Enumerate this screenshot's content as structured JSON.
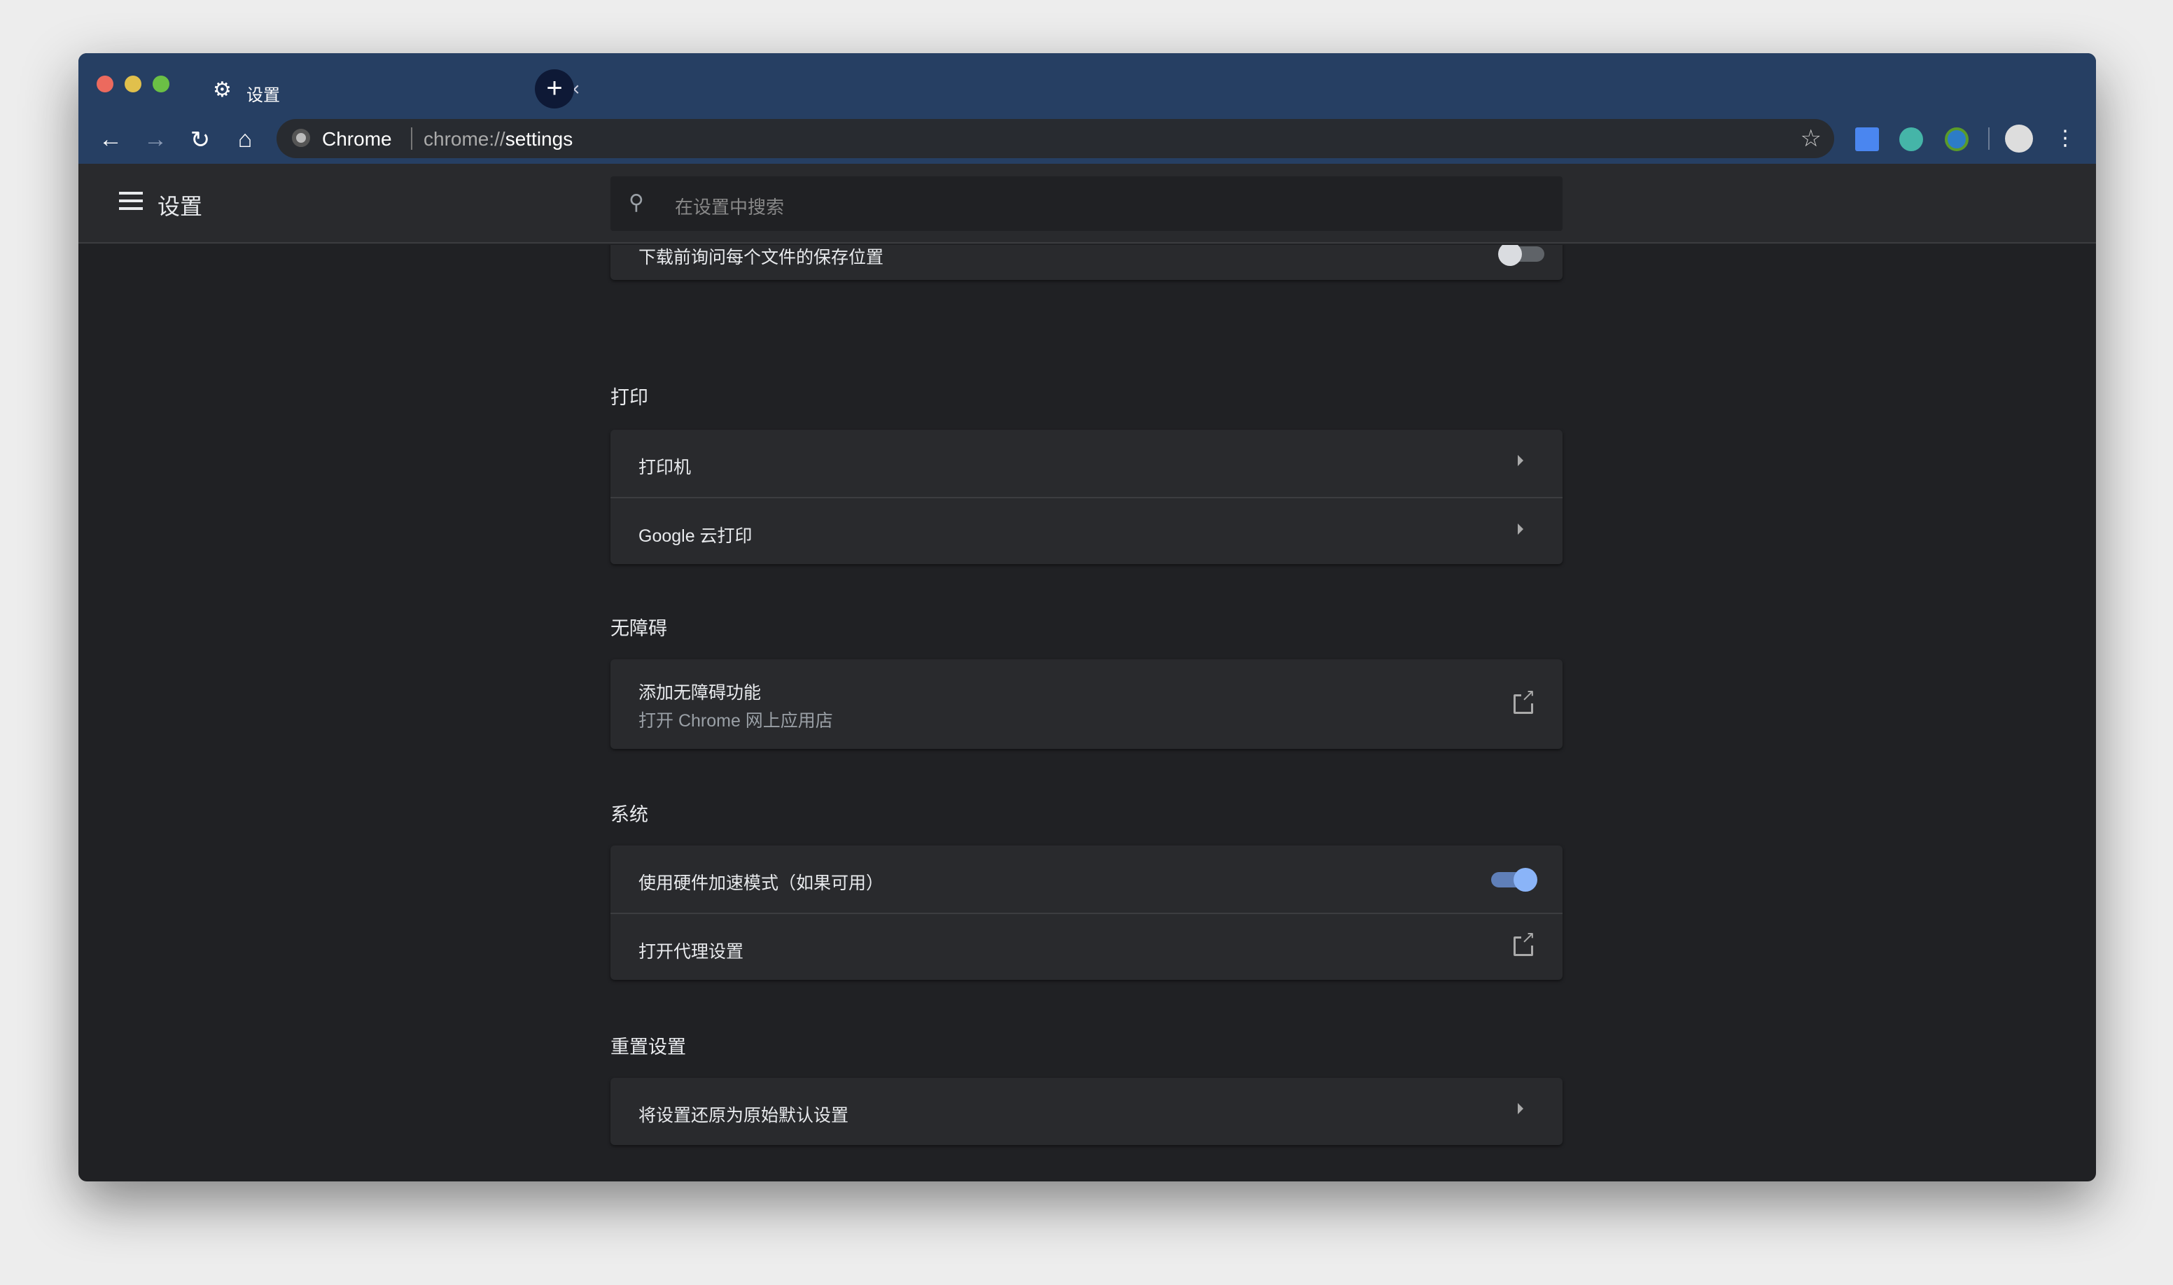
{
  "tab": {
    "title": "设置",
    "icon": "gear-icon"
  },
  "omnibox": {
    "site": "Chrome",
    "url_prefix": "chrome://",
    "url_path": "settings"
  },
  "header": {
    "title": "设置",
    "search_placeholder": "在设置中搜索"
  },
  "partial_row": {
    "label": "下载前询问每个文件的保存位置",
    "toggle_on": false
  },
  "sections": [
    {
      "title": "打印",
      "rows": [
        {
          "label": "打印机",
          "type": "arrow"
        },
        {
          "label": "Google 云打印",
          "type": "arrow"
        }
      ]
    },
    {
      "title": "无障碍",
      "rows": [
        {
          "label": "添加无障碍功能",
          "sublabel": "打开 Chrome 网上应用店",
          "type": "external"
        }
      ]
    },
    {
      "title": "系统",
      "rows": [
        {
          "label": "使用硬件加速模式（如果可用）",
          "type": "toggle",
          "toggle_on": true
        },
        {
          "label": "打开代理设置",
          "type": "external"
        }
      ]
    },
    {
      "title": "重置设置",
      "rows": [
        {
          "label": "将设置还原为原始默认设置",
          "type": "arrow"
        }
      ]
    }
  ],
  "colors": {
    "titlebar": "#263f63",
    "toggle_on": "#8ab4f8",
    "background": "#202124",
    "card": "#292a2d"
  }
}
